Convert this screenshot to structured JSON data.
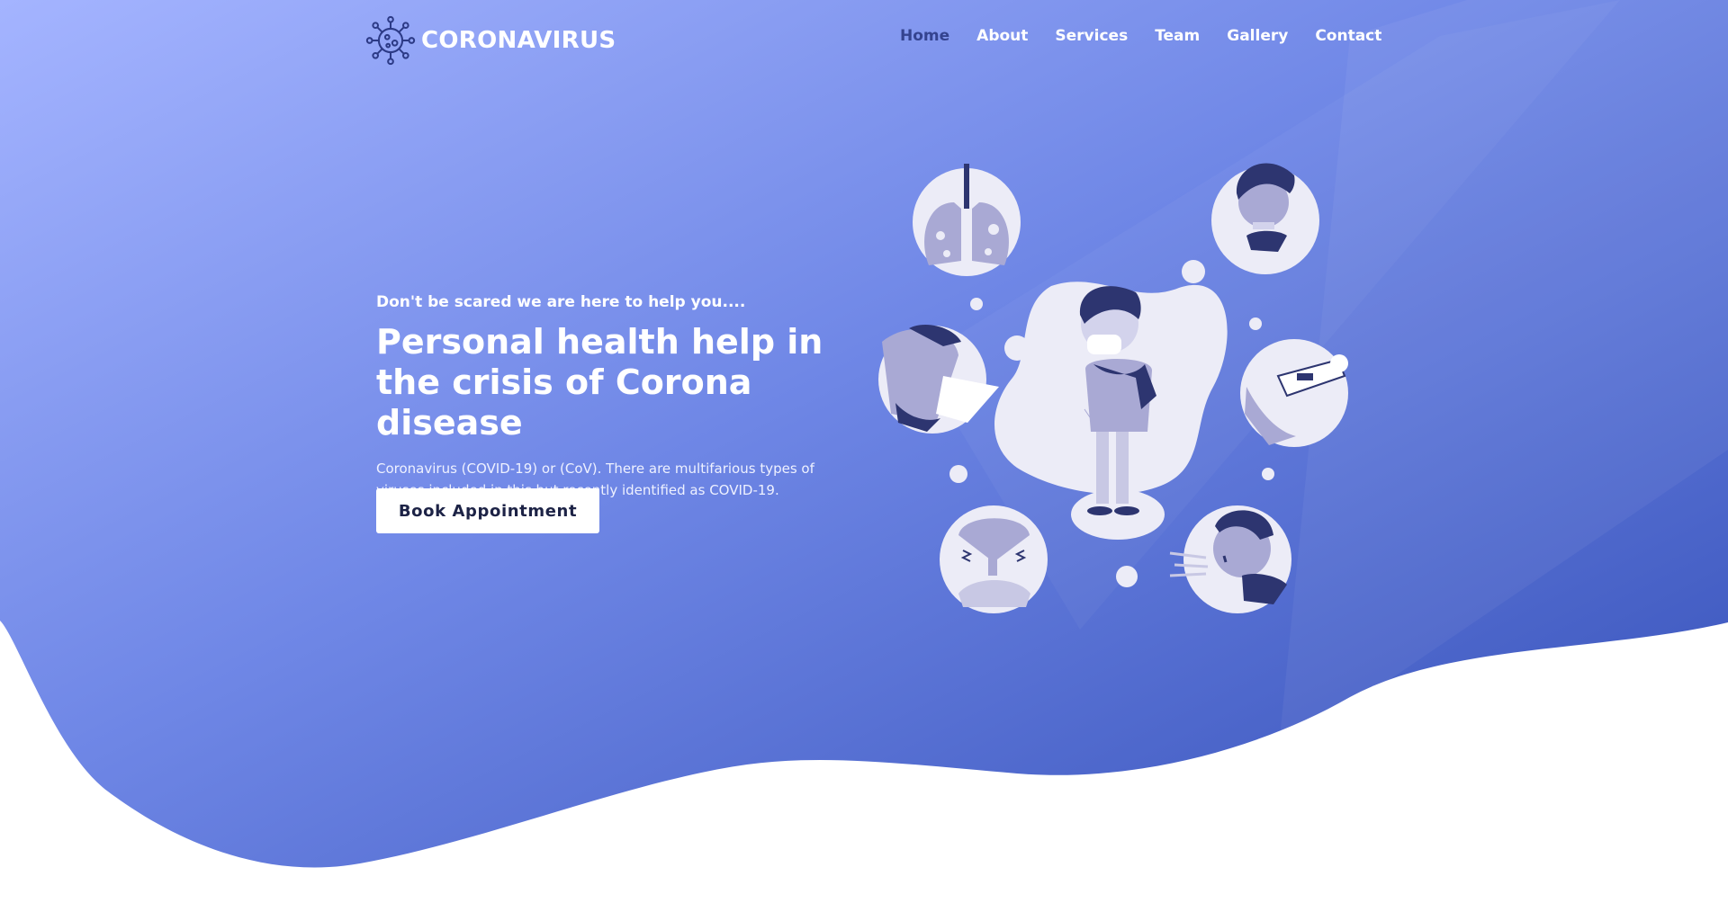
{
  "brand": {
    "name": "CORONAVIRUS",
    "logo_icon": "virus-icon"
  },
  "nav": {
    "items": [
      {
        "label": "Home",
        "active": true
      },
      {
        "label": "About",
        "active": false
      },
      {
        "label": "Services",
        "active": false
      },
      {
        "label": "Team",
        "active": false
      },
      {
        "label": "Gallery",
        "active": false
      },
      {
        "label": "Contact",
        "active": false
      }
    ]
  },
  "hero": {
    "tagline": "Don't be scared we are here to help you....",
    "title": "Personal health help in the crisis of Corona disease",
    "description": "Coronavirus (COVID-19) or (CoV). There are multifarious types of viruses included in this but recently identified as COVID-19.",
    "button_label": "Book Appointment"
  },
  "colors": {
    "gradient_start": "#9badff",
    "gradient_end": "#3a55bd",
    "active_nav": "#34438f",
    "illustration_light": "#ececf7",
    "illustration_mid": "#a9a9d4",
    "illustration_dark": "#2d3570"
  }
}
